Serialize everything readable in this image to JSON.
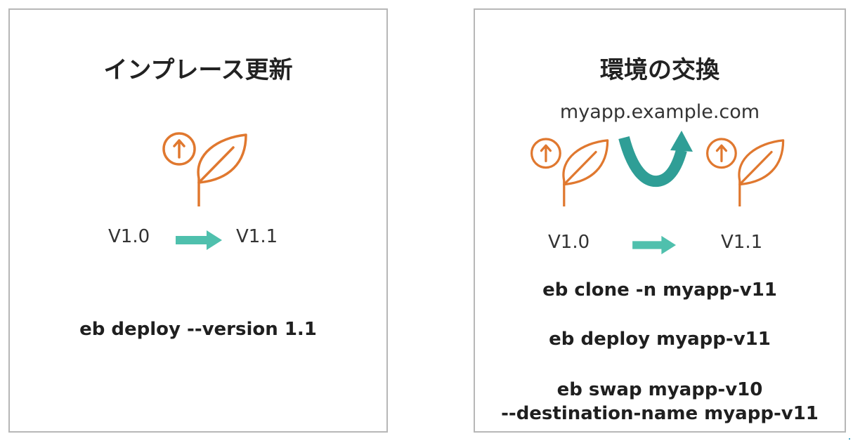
{
  "left_panel": {
    "title": "インプレース更新",
    "from_version": "V1.0",
    "to_version": "V1.1",
    "command": "eb deploy --version 1.1"
  },
  "right_panel": {
    "title": "環境の交換",
    "url": "myapp.example.com",
    "from_version": "V1.0",
    "to_version": "V1.1",
    "commands": [
      "eb clone -n myapp-v11",
      "eb deploy myapp-v11",
      "eb swap myapp-v10",
      "--destination-name myapp-v11"
    ]
  },
  "icons": {
    "beanstalk": "elastic-beanstalk-icon",
    "arrow": "right-arrow-icon",
    "swap": "swap-arrow-icon"
  },
  "colors": {
    "beanstalk_orange": "#e0782f",
    "arrow_teal": "#4fc0ad",
    "swap_teal": "#2f9e96",
    "border": "#b7b7b7"
  }
}
